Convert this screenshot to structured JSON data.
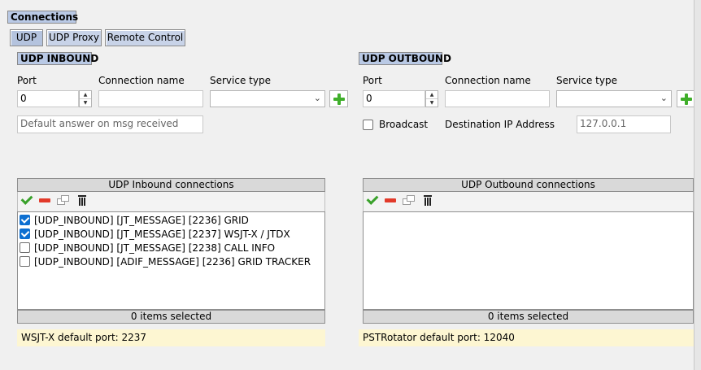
{
  "section_title": "Connections",
  "tabs": [
    {
      "label": "UDP",
      "active": true
    },
    {
      "label": "UDP Proxy",
      "active": false
    },
    {
      "label": "Remote Control",
      "active": false
    }
  ],
  "inbound": {
    "title": "UDP INBOUND",
    "port_label": "Port",
    "port_value": "0",
    "connection_name_label": "Connection name",
    "connection_name_value": "",
    "service_type_label": "Service type",
    "service_type_value": "",
    "default_answer_placeholder": "Default answer on msg received",
    "list_header": "UDP Inbound connections",
    "items": [
      {
        "label": "[UDP_INBOUND] [JT_MESSAGE] [2236] GRID",
        "checked": true
      },
      {
        "label": "[UDP_INBOUND] [JT_MESSAGE] [2237] WSJT-X / JTDX",
        "checked": true
      },
      {
        "label": "[UDP_INBOUND] [JT_MESSAGE] [2238] CALL INFO",
        "checked": false
      },
      {
        "label": "[UDP_INBOUND] [ADIF_MESSAGE] [2236] GRID TRACKER",
        "checked": false
      }
    ],
    "status": "0 items selected",
    "note": "WSJT-X default port: 2237"
  },
  "outbound": {
    "title": "UDP OUTBOUND",
    "port_label": "Port",
    "port_value": "0",
    "connection_name_label": "Connection name",
    "connection_name_value": "",
    "service_type_label": "Service type",
    "service_type_value": "",
    "broadcast_label": "Broadcast",
    "broadcast_checked": false,
    "destination_label": "Destination IP Address",
    "destination_value": "127.0.0.1",
    "list_header": "UDP Outbound connections",
    "items": [],
    "status": "0 items selected",
    "note": "PSTRotator default port: 12040"
  },
  "colors": {
    "header_bg": "#b9c9e5",
    "check_blue": "#0d6fd1",
    "add_green": "#3fae2a",
    "remove_red": "#e23a2a",
    "note_bg": "#fdf6d2"
  },
  "icons": [
    "plus-icon",
    "check-icon",
    "minus-icon",
    "duplicate-icon",
    "trash-icon",
    "spin-up-icon",
    "spin-down-icon",
    "chevron-down-icon"
  ]
}
